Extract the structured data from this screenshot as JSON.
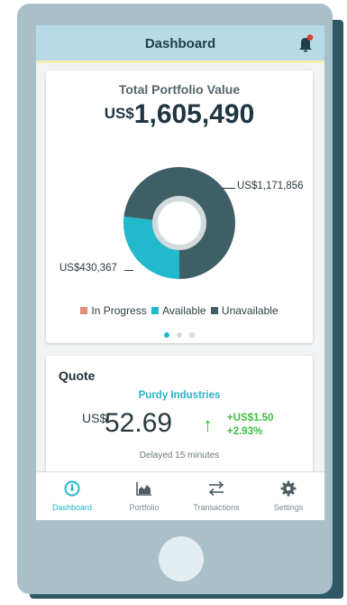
{
  "header": {
    "title": "Dashboard"
  },
  "portfolio": {
    "title": "Total Portfolio Value",
    "currency": "US$",
    "value": "1,605,490",
    "unavailable_label": "US$1,171,856",
    "available_label": "US$430,367"
  },
  "chart_data": {
    "type": "pie",
    "categories": [
      "In Progress",
      "Available",
      "Unavailable"
    ],
    "values": [
      0,
      430367,
      1171856
    ],
    "colors": [
      "#e58b7b",
      "#22b9cc",
      "#3f5f66"
    ],
    "legend_position": "bottom"
  },
  "legend": [
    {
      "label": "In Progress",
      "color": "#e58b7b"
    },
    {
      "label": "Available",
      "color": "#22b9cc"
    },
    {
      "label": "Unavailable",
      "color": "#3f5f66"
    }
  ],
  "carousel": {
    "active_index": 0,
    "count": 3
  },
  "quote": {
    "heading": "Quote",
    "company": "Purdy Industries",
    "currency": "US$",
    "price": "52.69",
    "change_abs": "+US$1.50",
    "change_pct": "+2.93%",
    "delayed": "Delayed 15 minutes"
  },
  "tabs": [
    {
      "label": "Dashboard",
      "icon": "gauge-icon",
      "active": true
    },
    {
      "label": "Portfolio",
      "icon": "area-chart-icon",
      "active": false
    },
    {
      "label": "Transactions",
      "icon": "transfer-arrows-icon",
      "active": false
    },
    {
      "label": "Settings",
      "icon": "gear-icon",
      "active": false
    }
  ],
  "colors": {
    "accent": "#24b9cc",
    "topbar": "#b6dbe6",
    "positive": "#3dc042",
    "notification_dot": "#e53935"
  }
}
